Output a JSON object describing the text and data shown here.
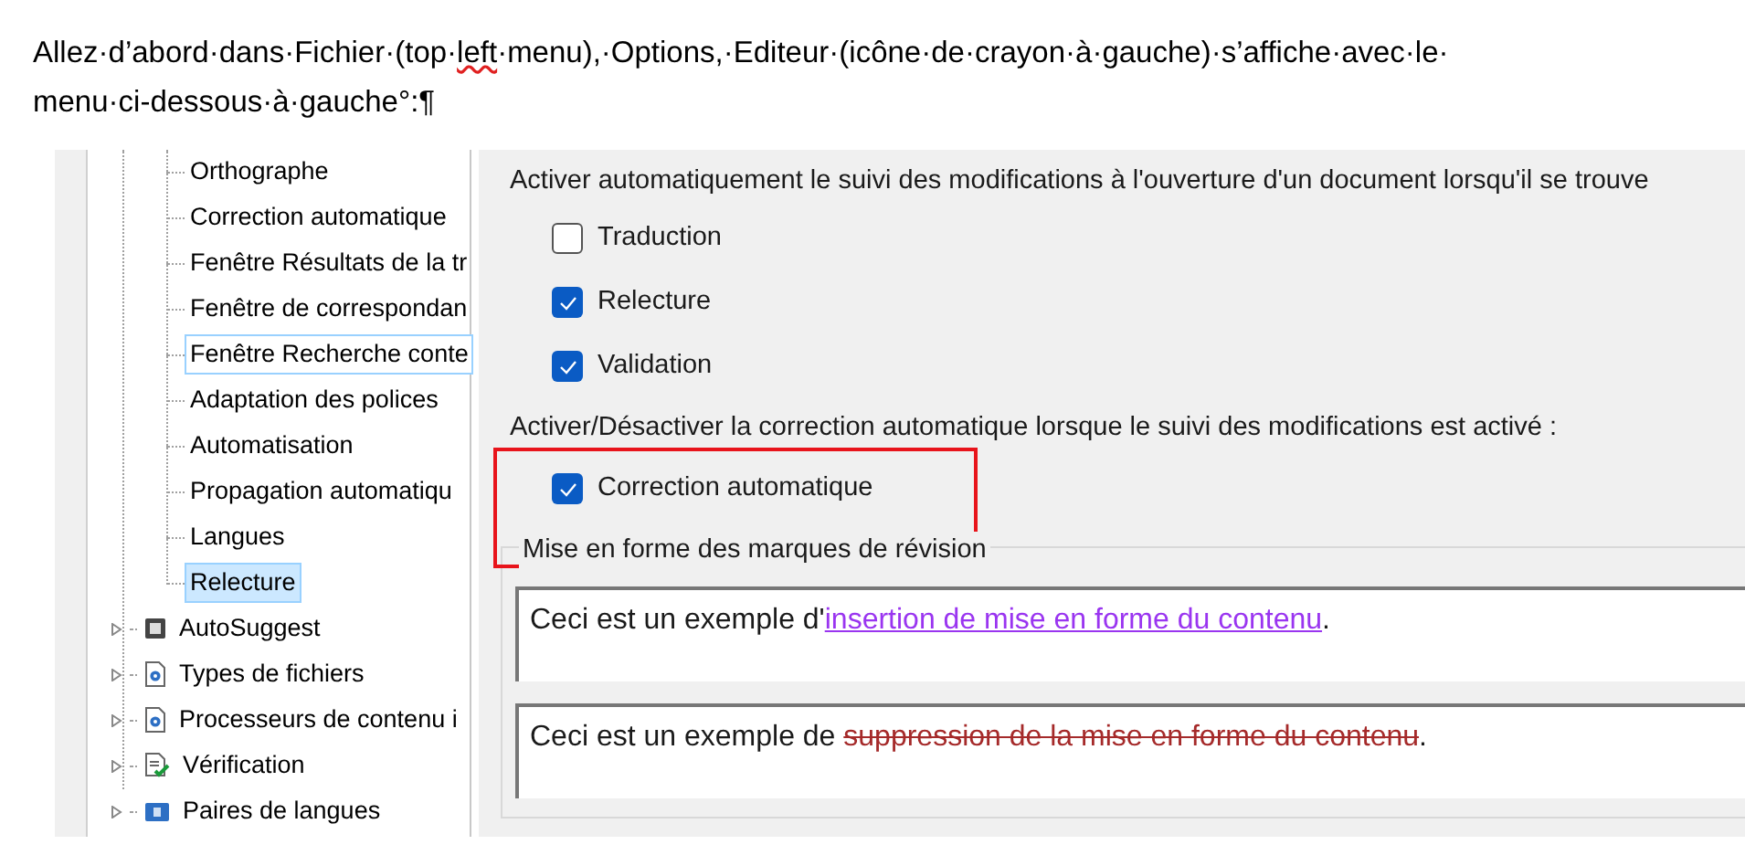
{
  "document": {
    "paragraph": [
      {
        "text": "Allez·d’abord·dans·Fichier·(top·",
        "misspelled": false
      },
      {
        "text": "left",
        "misspelled": true
      },
      {
        "text": "·menu),·Options,·Editeur·(icône·de·crayon·à·gauche)·s’affiche·avec·le·menu·ci-dessous·à·gauche°:¶",
        "misspelled": false
      }
    ]
  },
  "tree": {
    "children": [
      {
        "label": "Orthographe",
        "selected": false,
        "focused": false
      },
      {
        "label": "Correction automatique",
        "selected": false,
        "focused": false
      },
      {
        "label": "Fenêtre Résultats de la tr",
        "selected": false,
        "focused": false
      },
      {
        "label": "Fenêtre de correspondan",
        "selected": false,
        "focused": false
      },
      {
        "label": "Fenêtre Recherche conte",
        "selected": false,
        "focused": true
      },
      {
        "label": "Adaptation des polices",
        "selected": false,
        "focused": false
      },
      {
        "label": "Automatisation",
        "selected": false,
        "focused": false
      },
      {
        "label": "Propagation automatiqu",
        "selected": false,
        "focused": false
      },
      {
        "label": "Langues",
        "selected": false,
        "focused": false
      },
      {
        "label": "Relecture",
        "selected": true,
        "focused": false
      }
    ],
    "nodes": [
      {
        "label": "AutoSuggest",
        "expanded": false,
        "kind": "keyboard"
      },
      {
        "label": "Types de fichiers",
        "expanded": false,
        "kind": "gear"
      },
      {
        "label": "Processeurs de contenu i",
        "expanded": false,
        "kind": "gear"
      },
      {
        "label": "Vérification",
        "expanded": false,
        "kind": "check"
      },
      {
        "label": "Paires de langues",
        "expanded": false,
        "kind": "pair"
      }
    ]
  },
  "settings": {
    "auto_track_label": "Activer automatiquement le suivi des modifications à l'ouverture d'un document lorsqu'il se trouve",
    "auto_track": [
      {
        "label": "Traduction",
        "checked": false
      },
      {
        "label": "Relecture",
        "checked": true
      },
      {
        "label": "Validation",
        "checked": true
      }
    ],
    "autocorrect_label": "Activer/Désactiver la correction automatique lorsque le suivi des modifications est activé :",
    "autocorrect": [
      {
        "label": "Correction automatique",
        "checked": true
      }
    ],
    "group": {
      "title": "Mise en forme des marques de révision",
      "previews": [
        [
          {
            "text": "Ceci est un exemple d'",
            "kind": "plain"
          },
          {
            "text": "insertion de mise en forme du contenu",
            "kind": "insert"
          },
          {
            "text": ".",
            "kind": "plain"
          }
        ],
        [
          {
            "text": "Ceci est un exemple de ",
            "kind": "plain"
          },
          {
            "text": "suppression de la mise en forme du contenu",
            "kind": "delete"
          },
          {
            "text": ".",
            "kind": "plain"
          }
        ]
      ]
    }
  }
}
